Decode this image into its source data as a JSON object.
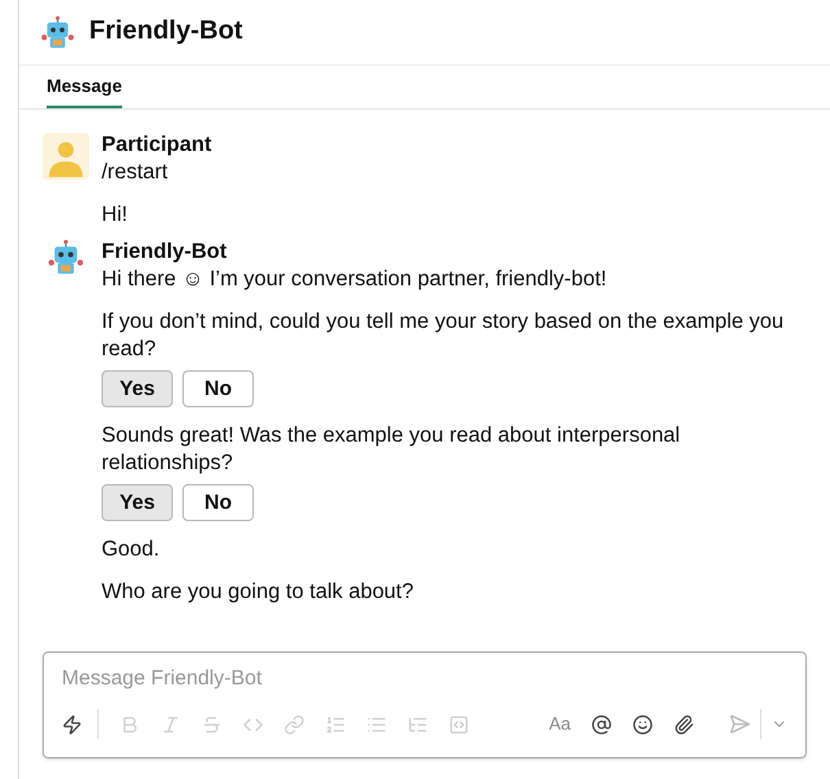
{
  "header": {
    "title": "Friendly-Bot"
  },
  "tabs": [
    {
      "label": "Message",
      "selected": true
    }
  ],
  "messages": [
    {
      "sender": "Participant",
      "kind": "person",
      "blocks": [
        {
          "kind": "text",
          "text": "/restart"
        },
        {
          "kind": "text",
          "text": "Hi!"
        }
      ]
    },
    {
      "sender": "Friendly-Bot",
      "kind": "robot",
      "blocks": [
        {
          "kind": "text",
          "text": "Hi there ☺ I’m your conversation partner, friendly-bot!"
        },
        {
          "kind": "text",
          "text": "If you don’t mind, could you tell me your story based on the example you read?"
        },
        {
          "kind": "buttons",
          "options": [
            {
              "label": "Yes",
              "selected": true
            },
            {
              "label": "No",
              "selected": false
            }
          ]
        },
        {
          "kind": "text",
          "text": "Sounds great! Was the example you read about interpersonal relationships?"
        },
        {
          "kind": "buttons",
          "options": [
            {
              "label": "Yes",
              "selected": true
            },
            {
              "label": "No",
              "selected": false
            }
          ]
        },
        {
          "kind": "text",
          "text": "Good."
        },
        {
          "kind": "text",
          "text": "Who are you going to talk about?"
        }
      ]
    }
  ],
  "composer": {
    "placeholder": "Message Friendly-Bot",
    "format_label": "Aa",
    "tools": [
      {
        "kind": "shortcut",
        "disabled": false
      },
      {
        "kind": "bold",
        "disabled": true
      },
      {
        "kind": "italic",
        "disabled": true
      },
      {
        "kind": "strike",
        "disabled": true
      },
      {
        "kind": "code",
        "disabled": true
      },
      {
        "kind": "link",
        "disabled": true
      },
      {
        "kind": "ordered",
        "disabled": true
      },
      {
        "kind": "bullets",
        "disabled": true
      },
      {
        "kind": "indent",
        "disabled": true
      },
      {
        "kind": "codeblock",
        "disabled": true
      }
    ],
    "actions": [
      {
        "kind": "mention",
        "disabled": false
      },
      {
        "kind": "emoji",
        "disabled": false
      },
      {
        "kind": "attach",
        "disabled": false
      }
    ]
  }
}
